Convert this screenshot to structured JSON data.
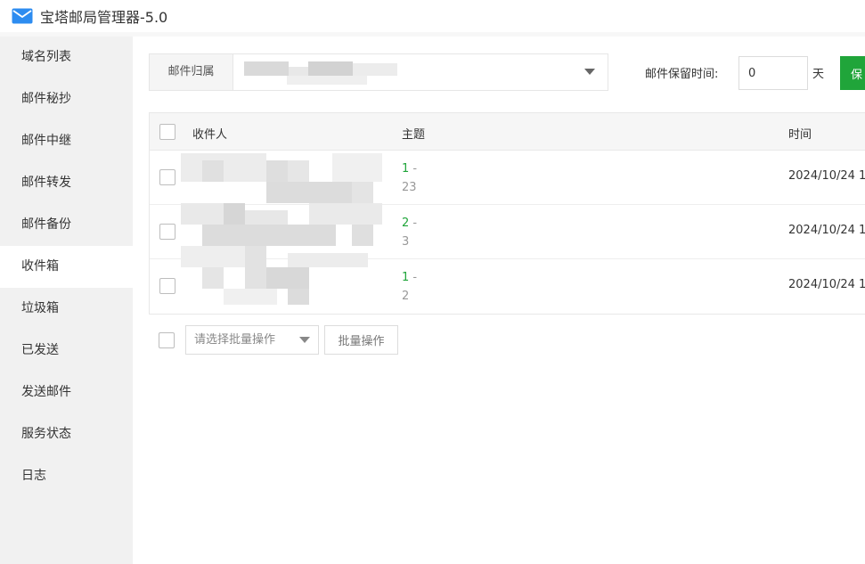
{
  "window": {
    "title": "宝塔邮局管理器-5.0"
  },
  "sidebar": {
    "items": [
      {
        "label": "域名列表"
      },
      {
        "label": "邮件秘抄"
      },
      {
        "label": "邮件中继"
      },
      {
        "label": "邮件转发"
      },
      {
        "label": "邮件备份"
      },
      {
        "label": "收件箱"
      },
      {
        "label": "垃圾箱"
      },
      {
        "label": "已发送"
      },
      {
        "label": "发送邮件"
      },
      {
        "label": "服务状态"
      },
      {
        "label": "日志"
      }
    ],
    "active_index": 5
  },
  "filter": {
    "owner_label": "邮件归属",
    "keep_label": "邮件保留时间:",
    "keep_value": "0",
    "keep_unit": "天",
    "save_label": "保"
  },
  "table": {
    "headers": {
      "recipient": "收件人",
      "subject": "主题",
      "time": "时间"
    },
    "rows": [
      {
        "subject_main": "1",
        "subject_sep": " -",
        "subject_sub": "23",
        "time": "2024/10/24 1"
      },
      {
        "subject_main": "2",
        "subject_sep": " -",
        "subject_sub": "3",
        "time": "2024/10/24 1"
      },
      {
        "subject_main": "1",
        "subject_sep": " -",
        "subject_sub": "2",
        "time": "2024/10/24 1"
      }
    ]
  },
  "batch": {
    "select_placeholder": "请选择批量操作",
    "button_label": "批量操作"
  },
  "colors": {
    "accent": "#20a53a",
    "sidebar_bg": "#f1f1f1"
  },
  "icons": {
    "app": "mail-icon"
  }
}
